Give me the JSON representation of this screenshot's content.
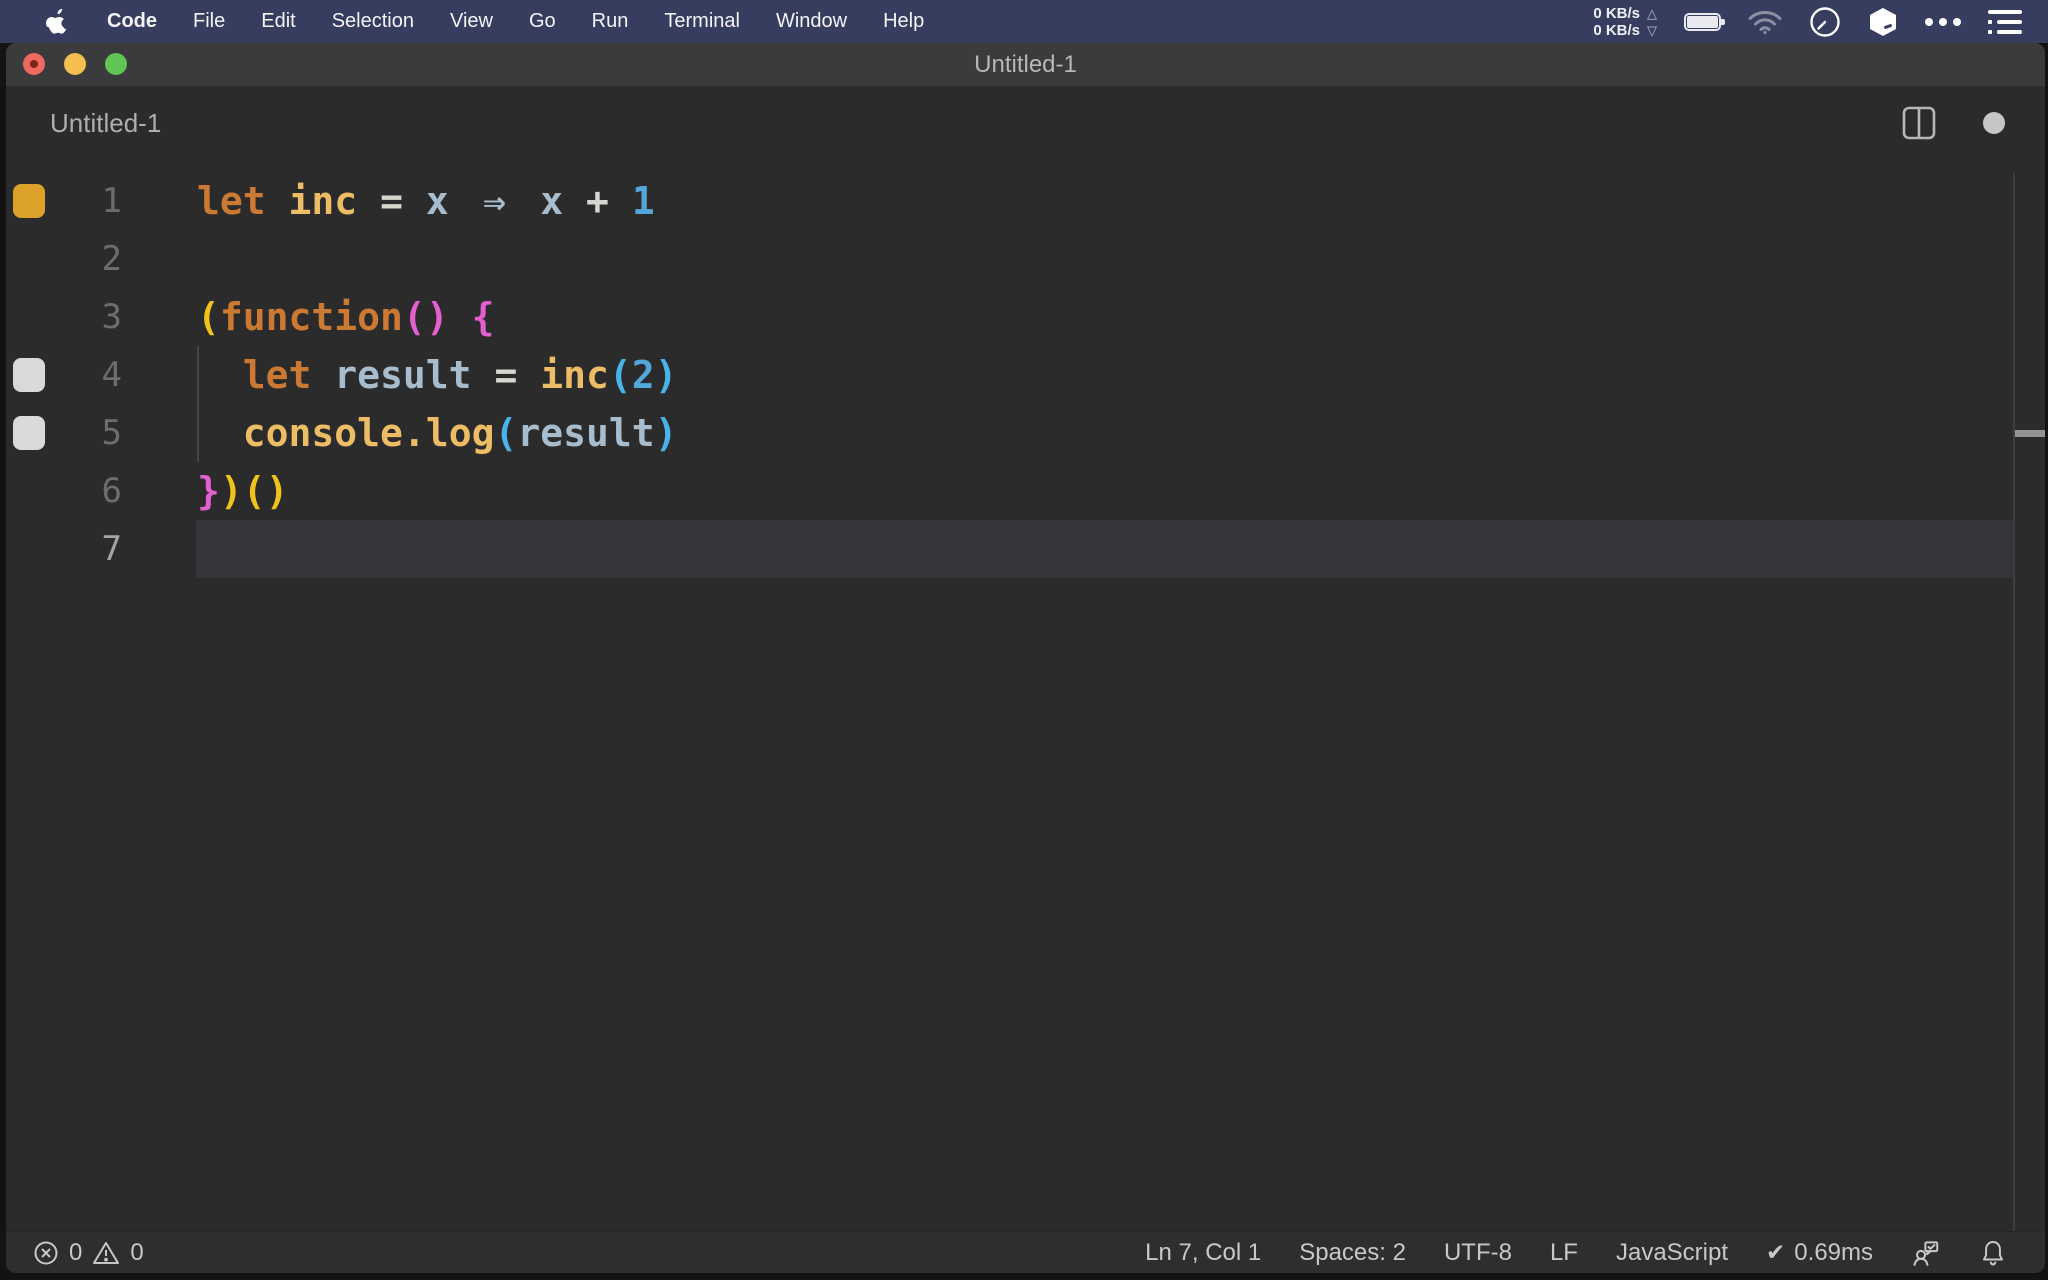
{
  "menubar": {
    "apple_icon": "apple-logo",
    "items": [
      {
        "label": "Code",
        "bold": true
      },
      {
        "label": "File"
      },
      {
        "label": "Edit"
      },
      {
        "label": "Selection"
      },
      {
        "label": "View"
      },
      {
        "label": "Go"
      },
      {
        "label": "Run"
      },
      {
        "label": "Terminal"
      },
      {
        "label": "Window"
      },
      {
        "label": "Help"
      }
    ],
    "status": {
      "net_up": "0 KB/s",
      "net_down": "0 KB/s",
      "up_triangle": "△",
      "down_triangle": "▽",
      "icons": [
        "battery-icon",
        "wifi-icon",
        "clock-icon",
        "cube-icon",
        "more-icon",
        "list-icon"
      ]
    }
  },
  "window": {
    "title": "Untitled-1",
    "controls": [
      "close-button",
      "minimize-button",
      "zoom-button"
    ],
    "modified": true
  },
  "editor_header": {
    "label": "Untitled-1",
    "actions": [
      "split-editor-icon",
      "modified-dot"
    ]
  },
  "editor": {
    "language": "JavaScript",
    "active_line": 7,
    "cursor": {
      "line": 7,
      "col": 1
    },
    "token_colors": {
      "kw": "#cc7a33",
      "fn": "#edbd66",
      "var": "#a7bccd",
      "arrow": "#a7bccd",
      "op": "#d7d7d1",
      "num": "#54a7da",
      "b1": "#f0c31c",
      "b2": "#e45fd0",
      "b3": "#49b4ea"
    },
    "indicator_colors": {
      "orange": "#dba128",
      "gray": "#d9d9d9"
    },
    "indent_guides": [
      {
        "from_line": 4,
        "to_line": 5
      }
    ],
    "lines": [
      {
        "num": 1,
        "indicator": "orange",
        "tokens": [
          [
            "let",
            "kw"
          ],
          [
            " "
          ],
          [
            "inc",
            "fn"
          ],
          [
            " "
          ],
          [
            "=",
            "op"
          ],
          [
            " "
          ],
          [
            "x",
            "var"
          ],
          [
            " "
          ],
          [
            "⇒",
            "arrow"
          ],
          [
            " "
          ],
          [
            "x",
            "var"
          ],
          [
            " "
          ],
          [
            "+",
            "op"
          ],
          [
            " "
          ],
          [
            "1",
            "num"
          ]
        ]
      },
      {
        "num": 2,
        "tokens": []
      },
      {
        "num": 3,
        "tokens": [
          [
            "(",
            "b1"
          ],
          [
            "function",
            "kw"
          ],
          [
            "(",
            "b2"
          ],
          [
            ")",
            "b2"
          ],
          [
            " "
          ],
          [
            "{",
            "b2"
          ]
        ]
      },
      {
        "num": 4,
        "indicator": "gray",
        "tokens": [
          [
            "  "
          ],
          [
            "let",
            "kw"
          ],
          [
            " "
          ],
          [
            "result",
            "var"
          ],
          [
            " "
          ],
          [
            "=",
            "op"
          ],
          [
            " "
          ],
          [
            "inc",
            "fn"
          ],
          [
            "(",
            "b3"
          ],
          [
            "2",
            "num"
          ],
          [
            ")",
            "b3"
          ]
        ]
      },
      {
        "num": 5,
        "indicator": "gray",
        "tokens": [
          [
            "  "
          ],
          [
            "console",
            "fn"
          ],
          [
            ".",
            "fn"
          ],
          [
            "log",
            "fn"
          ],
          [
            "(",
            "b3"
          ],
          [
            "result",
            "var"
          ],
          [
            ")",
            "b3"
          ]
        ]
      },
      {
        "num": 6,
        "tokens": [
          [
            "}",
            "b2"
          ],
          [
            ")",
            "b1"
          ],
          [
            "(",
            "b1"
          ],
          [
            ")",
            "b1"
          ]
        ]
      },
      {
        "num": 7,
        "tokens": []
      }
    ]
  },
  "statusbar": {
    "errors": "0",
    "warnings": "0",
    "right_items": [
      {
        "label": "Ln 7, Col 1"
      },
      {
        "label": "Spaces: 2"
      },
      {
        "label": "UTF-8"
      },
      {
        "label": "LF"
      },
      {
        "label": "JavaScript"
      },
      {
        "icon": "check",
        "check_glyph": "✔",
        "label": "0.69ms"
      }
    ],
    "right_icons": [
      "feedback-icon",
      "bell-icon"
    ]
  }
}
